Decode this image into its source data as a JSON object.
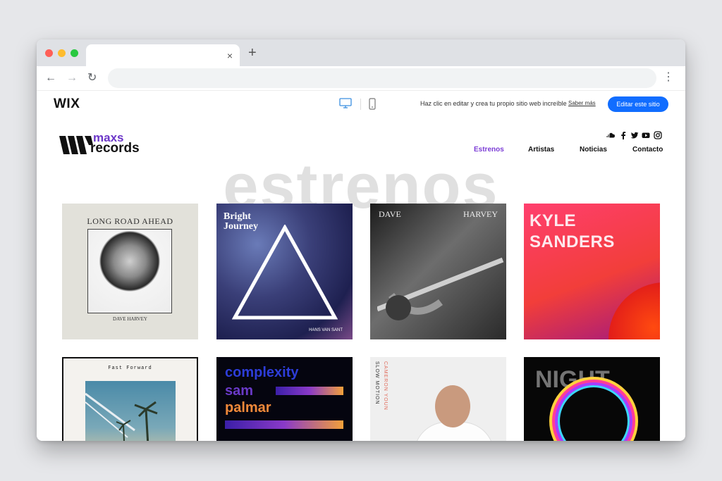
{
  "browser": {
    "traffic_lights": {
      "close": "#ff5f57",
      "minimize": "#febc2e",
      "zoom": "#28c840"
    },
    "tab": {
      "title": "",
      "close_symbol": "×"
    },
    "new_tab_symbol": "+",
    "nav": {
      "back": "←",
      "forward": "→",
      "reload": "↻",
      "menu": "⋮"
    },
    "address": ""
  },
  "wix_bar": {
    "logo": "WIX",
    "message": "Haz clic en editar y crea tu propio sitio web increíble",
    "learn_more": "Saber más",
    "edit_button": "Editar este sitio",
    "accent": "#116dff"
  },
  "site": {
    "brand": {
      "line1": "maxs",
      "line2": "records",
      "accent": "#6b36c8"
    },
    "social_icons": [
      "soundcloud-icon",
      "facebook-icon",
      "twitter-icon",
      "youtube-icon",
      "instagram-icon"
    ],
    "nav": [
      {
        "label": "Estrenos",
        "active": true
      },
      {
        "label": "Artistas",
        "active": false
      },
      {
        "label": "Noticias",
        "active": false
      },
      {
        "label": "Contacto",
        "active": false
      }
    ],
    "hero_title": "estrenos",
    "albums": [
      {
        "title": "LONG ROAD AHEAD",
        "artist": "DAVE HARVEY"
      },
      {
        "title_line1": "Bright",
        "title_line2": "Journey",
        "artist": "HANS VAN SANT"
      },
      {
        "title_left": "DAVE",
        "title_right": "HARVEY"
      },
      {
        "line1": "KYLE",
        "line2": "SANDERS"
      },
      {
        "title": "Fast Forward"
      },
      {
        "line1": "complexity",
        "line2": "sam",
        "line3": "palmar"
      },
      {
        "title": "SLOW MOTION",
        "artist": "CAMERON YOUN"
      },
      {
        "title": "NIGHT"
      }
    ]
  }
}
